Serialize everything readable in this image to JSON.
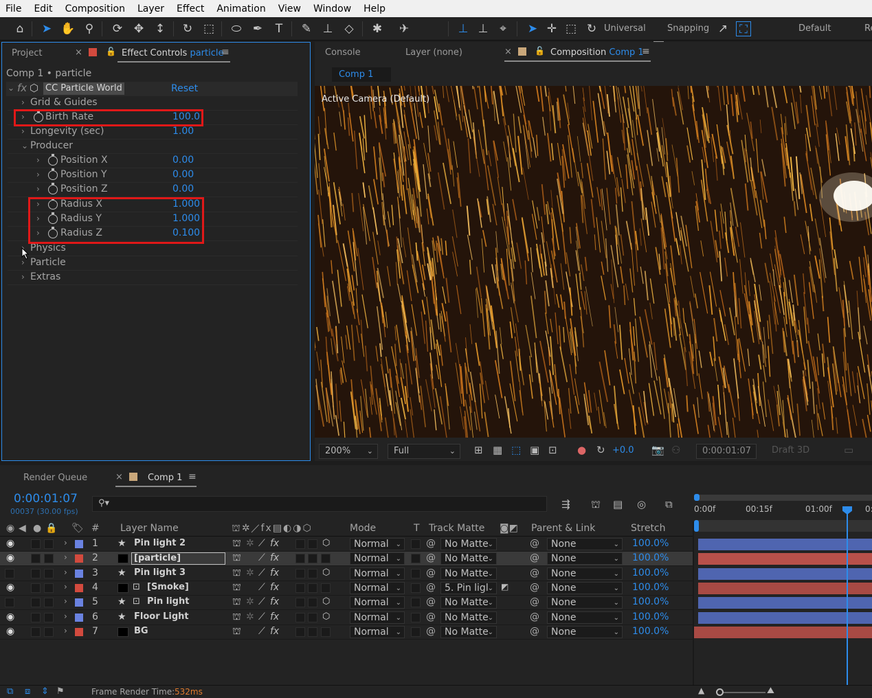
{
  "menu": [
    "File",
    "Edit",
    "Composition",
    "Layer",
    "Effect",
    "Animation",
    "View",
    "Window",
    "Help"
  ],
  "toolbar": {
    "universal": "Universal",
    "snapping": "Snapping",
    "workspace": "Default",
    "workspace2": "Re"
  },
  "project_tab": "Project",
  "effect_tab": {
    "label": "Effect Controls",
    "layer": "particle"
  },
  "effect": {
    "breadcrumb": "Comp 1 • particle",
    "name": "CC Particle World",
    "reset": "Reset",
    "rows": [
      {
        "label": "Grid & Guides",
        "value": ""
      },
      {
        "label": "Birth Rate",
        "value": "100.0"
      },
      {
        "label": "Longevity (sec)",
        "value": "1.00"
      },
      {
        "label": "Producer",
        "value": ""
      },
      {
        "label": "Position X",
        "value": "0.00"
      },
      {
        "label": "Position Y",
        "value": "0.00"
      },
      {
        "label": "Position Z",
        "value": "0.00"
      },
      {
        "label": "Radius X",
        "value": "1.000"
      },
      {
        "label": "Radius Y",
        "value": "1.000"
      },
      {
        "label": "Radius Z",
        "value": "0.100"
      },
      {
        "label": "Physics",
        "value": ""
      },
      {
        "label": "Particle",
        "value": ""
      },
      {
        "label": "Extras",
        "value": ""
      }
    ]
  },
  "comp_tabs": {
    "console": "Console",
    "layer": "Layer (none)",
    "composition": "Composition",
    "comp_name": "Comp 1",
    "subtab": "Comp 1"
  },
  "viewer": {
    "camera": "Active Camera (Default)",
    "zoom": "200%",
    "resolution": "Full",
    "exposure": "+0.0",
    "timecode": "0:00:01:07",
    "draft": "Draft 3D"
  },
  "timeline": {
    "render_queue": "Render Queue",
    "comp_tab": "Comp 1",
    "time": "0:00:01:07",
    "frames": "00037 (30.00 fps)",
    "search_icon": "search-icon",
    "headers": {
      "num": "#",
      "name": "Layer Name",
      "mode": "Mode",
      "t": "T",
      "matte": "Track Matte",
      "parent": "Parent & Link",
      "stretch": "Stretch"
    },
    "ruler": [
      "0:00f",
      "00:15f",
      "01:00f",
      "0:"
    ],
    "layers": [
      {
        "num": "1",
        "name": "Pin light 2",
        "mode": "Normal",
        "matte": "No Matte",
        "parent": "None",
        "stretch": "100.0%",
        "color": "#6a82e0",
        "bar": "#4f65b0"
      },
      {
        "num": "2",
        "name": "[particle]",
        "mode": "Normal",
        "matte": "No Matte",
        "parent": "None",
        "stretch": "100.0%",
        "color": "#d24a3e",
        "bar": "#b8504a"
      },
      {
        "num": "3",
        "name": "Pin light 3",
        "mode": "Normal",
        "matte": "No Matte",
        "parent": "None",
        "stretch": "100.0%",
        "color": "#6a82e0",
        "bar": "#4f65b0"
      },
      {
        "num": "4",
        "name": "[Smoke]",
        "mode": "Normal",
        "matte": "5. Pin ligl",
        "parent": "None",
        "stretch": "100.0%",
        "color": "#d24a3e",
        "bar": "#a84a44"
      },
      {
        "num": "5",
        "name": "Pin light",
        "mode": "Normal",
        "matte": "No Matte",
        "parent": "None",
        "stretch": "100.0%",
        "color": "#6a82e0",
        "bar": "#4f65b0"
      },
      {
        "num": "6",
        "name": "Floor Light",
        "mode": "Normal",
        "matte": "No Matte",
        "parent": "None",
        "stretch": "100.0%",
        "color": "#6a82e0",
        "bar": "#4f65b0"
      },
      {
        "num": "7",
        "name": "BG",
        "mode": "Normal",
        "matte": "No Matte",
        "parent": "None",
        "stretch": "100.0%",
        "color": "#d24a3e",
        "bar": "#a84a44"
      }
    ]
  },
  "status": {
    "label": "Frame Render Time:",
    "value": "532ms"
  },
  "colors": {
    "accent": "#2d8ceb",
    "highlight_box": "#e01818"
  }
}
